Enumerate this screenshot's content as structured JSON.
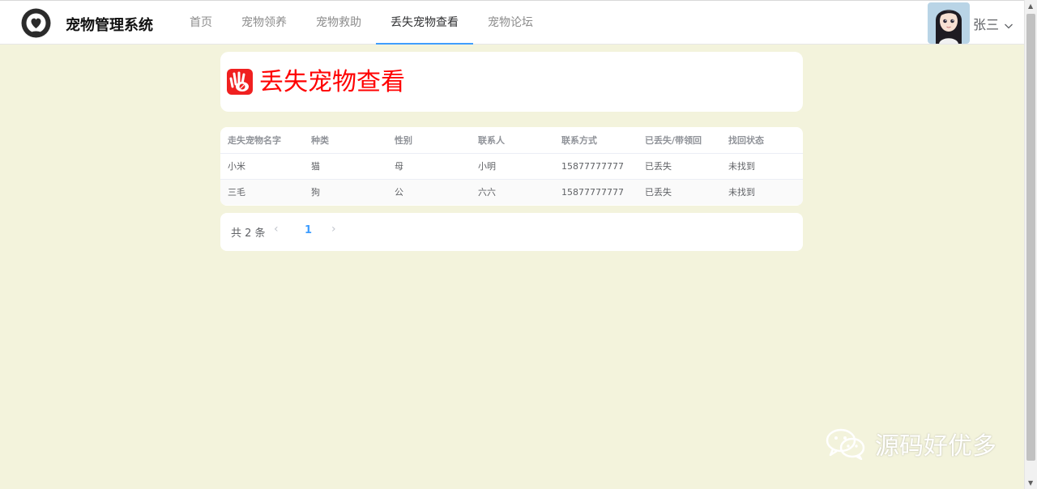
{
  "header": {
    "app_title": "宠物管理系统",
    "logo_icon": "heart-person-icon",
    "nav": [
      {
        "label": "首页",
        "active": false
      },
      {
        "label": "宠物领养",
        "active": false
      },
      {
        "label": "宠物救助",
        "active": false
      },
      {
        "label": "丢失宠物查看",
        "active": true
      },
      {
        "label": "宠物论坛",
        "active": false
      }
    ],
    "user": {
      "name": "张三",
      "avatar": "avatar-image"
    }
  },
  "page": {
    "title": "丢失宠物查看",
    "title_color": "#ff0000",
    "icon": "paw-hand-icon"
  },
  "table": {
    "headers": [
      "走失宠物名字",
      "种类",
      "性别",
      "联系人",
      "联系方式",
      "已丢失/带领回",
      "找回状态"
    ],
    "rows": [
      [
        "小米",
        "猫",
        "母",
        "小明",
        "15877777777",
        "已丢失",
        "未找到"
      ],
      [
        "三毛",
        "狗",
        "公",
        "六六",
        "15877777777",
        "已丢失",
        "未找到"
      ]
    ]
  },
  "pagination": {
    "total": "共 2 条",
    "current": "1",
    "prev": "‹",
    "next": "›"
  },
  "watermark": {
    "text": "源码好优多",
    "icon": "wechat-icon"
  },
  "colors": {
    "background": "#f3f3dc",
    "accent": "#409eff"
  }
}
